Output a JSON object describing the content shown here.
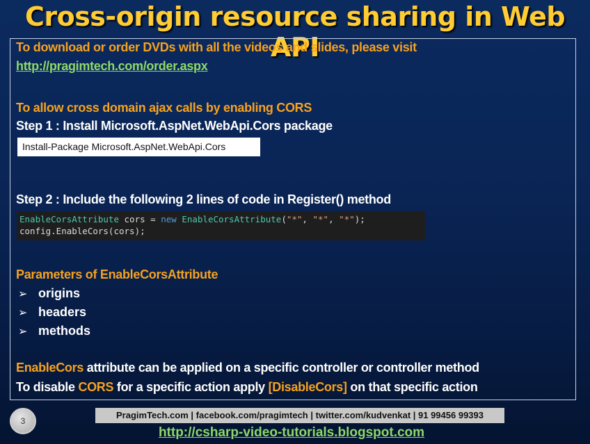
{
  "title": "Cross-origin resource sharing in Web API",
  "intro": {
    "text": "To download or order DVDs with all the videos and slides, please visit",
    "url": "http://pragimtech.com/order.aspx"
  },
  "cors_heading": "To allow cross domain ajax calls by enabling CORS",
  "step1": {
    "label": "Step 1 : Install Microsoft.AspNet.WebApi.Cors package",
    "command": "Install-Package Microsoft.AspNet.WebApi.Cors"
  },
  "step2": {
    "label": "Step 2 : Include the following 2 lines of code in Register() method",
    "code": {
      "line1_type": "EnableCorsAttribute",
      "line1_var": " cors = ",
      "line1_new": "new",
      "line1_ctor": " EnableCorsAttribute",
      "line1_open": "(",
      "line1_arg1": "\"*\"",
      "line1_sep1": ", ",
      "line1_arg2": "\"*\"",
      "line1_sep2": ", ",
      "line1_arg3": "\"*\"",
      "line1_close": ");",
      "line2": "config.EnableCors(cors);"
    }
  },
  "params": {
    "heading": "Parameters of EnableCorsAttribute",
    "bullet_glyph": "➢",
    "items": [
      "origins",
      "headers",
      "methods"
    ]
  },
  "note1": {
    "highlight": "EnableCors",
    "rest": " attribute can be applied on a specific controller or controller method"
  },
  "note2": {
    "pre": "To disable ",
    "cors": "CORS",
    "mid": " for a specific action apply ",
    "attr": "[DisableCors]",
    "post": " on that specific action"
  },
  "footer": {
    "page_number": "3",
    "contact": "PragimTech.com | facebook.com/pragimtech  | twitter.com/kudvenkat  | 91 99456 99393",
    "blog_url": "http://csharp-video-tutorials.blogspot.com"
  }
}
